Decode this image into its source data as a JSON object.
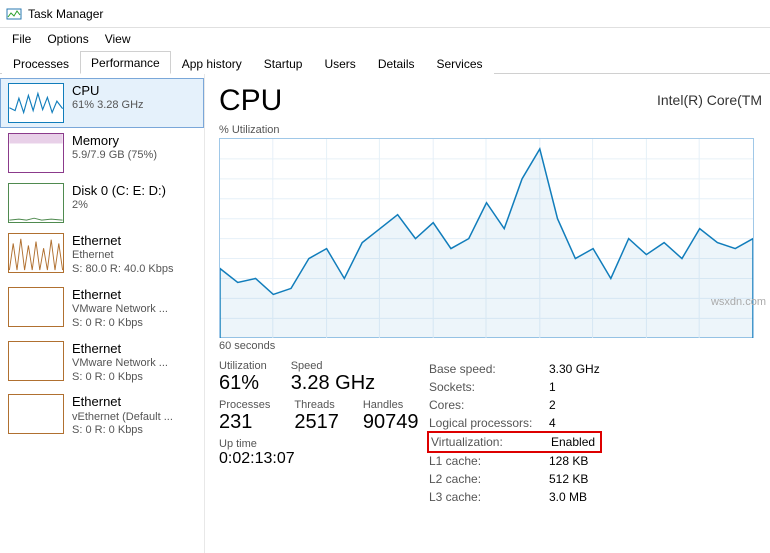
{
  "window": {
    "title": "Task Manager"
  },
  "menu": [
    "File",
    "Options",
    "View"
  ],
  "tabs": [
    "Processes",
    "Performance",
    "App history",
    "Startup",
    "Users",
    "Details",
    "Services"
  ],
  "active_tab": 1,
  "sidebar": {
    "items": [
      {
        "name": "CPU",
        "sub": "61%  3.28 GHz",
        "sub2": ""
      },
      {
        "name": "Memory",
        "sub": "5.9/7.9 GB (75%)",
        "sub2": ""
      },
      {
        "name": "Disk 0 (C: E: D:)",
        "sub": "2%",
        "sub2": ""
      },
      {
        "name": "Ethernet",
        "sub": "Ethernet",
        "sub2": "S: 80.0 R: 40.0 Kbps"
      },
      {
        "name": "Ethernet",
        "sub": "VMware Network ...",
        "sub2": "S: 0 R: 0 Kbps"
      },
      {
        "name": "Ethernet",
        "sub": "VMware Network ...",
        "sub2": "S: 0 R: 0 Kbps"
      },
      {
        "name": "Ethernet",
        "sub": "vEthernet (Default ...",
        "sub2": "S: 0 R: 0 Kbps"
      }
    ],
    "selected": 0
  },
  "detail": {
    "title": "CPU",
    "model": "Intel(R) Core(TM",
    "chart_label": "% Utilization",
    "chart_footer": "60 seconds",
    "utilization_label": "Utilization",
    "utilization": "61%",
    "speed_label": "Speed",
    "speed": "3.28 GHz",
    "processes_label": "Processes",
    "processes": "231",
    "threads_label": "Threads",
    "threads": "2517",
    "handles_label": "Handles",
    "handles": "90749",
    "uptime_label": "Up time",
    "uptime": "0:02:13:07",
    "info": [
      {
        "k": "Base speed:",
        "v": "3.30 GHz"
      },
      {
        "k": "Sockets:",
        "v": "1"
      },
      {
        "k": "Cores:",
        "v": "2"
      },
      {
        "k": "Logical processors:",
        "v": "4"
      },
      {
        "k": "Virtualization:",
        "v": "Enabled",
        "highlight": true
      },
      {
        "k": "L1 cache:",
        "v": "128 KB"
      },
      {
        "k": "L2 cache:",
        "v": "512 KB"
      },
      {
        "k": "L3 cache:",
        "v": "3.0 MB"
      }
    ]
  },
  "watermark": "wsxdn.com",
  "chart_data": {
    "type": "line",
    "title": "% Utilization",
    "xlabel": "60 seconds",
    "ylabel": "% Utilization",
    "ylim": [
      0,
      100
    ],
    "x_seconds_ago": [
      60,
      58,
      56,
      54,
      52,
      50,
      48,
      46,
      44,
      42,
      40,
      38,
      36,
      34,
      32,
      30,
      28,
      26,
      24,
      22,
      20,
      18,
      16,
      14,
      12,
      10,
      8,
      6,
      4,
      2,
      0
    ],
    "values": [
      35,
      28,
      30,
      22,
      25,
      40,
      45,
      30,
      48,
      55,
      62,
      50,
      58,
      45,
      50,
      68,
      55,
      80,
      95,
      60,
      40,
      45,
      30,
      50,
      42,
      48,
      40,
      55,
      48,
      45,
      50
    ]
  }
}
